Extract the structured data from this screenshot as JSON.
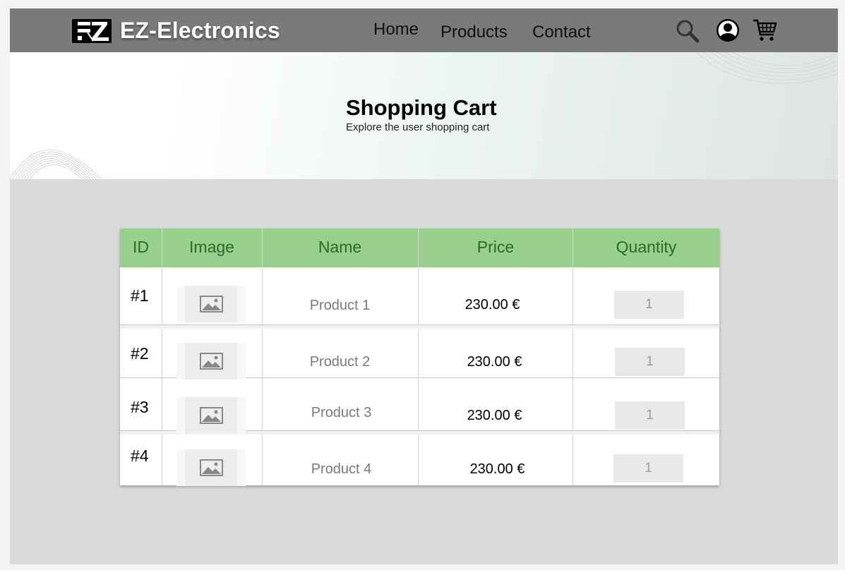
{
  "header": {
    "brand": "EZ-Electronics",
    "nav": [
      "Home",
      "Products",
      "Contact"
    ],
    "icons": [
      "search-icon",
      "user-icon",
      "cart-icon"
    ]
  },
  "hero": {
    "title": "Shopping Cart",
    "subtitle": "Explore the user shopping cart"
  },
  "cart": {
    "columns": [
      "ID",
      "Image",
      "Name",
      "Price",
      "Quantity"
    ],
    "rows": [
      {
        "id": "#1",
        "image": "image-placeholder-icon",
        "name": "Product 1",
        "price": "230.00 €",
        "quantity": "1"
      },
      {
        "id": "#2",
        "image": "image-placeholder-icon",
        "name": "Product 2",
        "price": "230.00 €",
        "quantity": "1"
      },
      {
        "id": "#3",
        "image": "image-placeholder-icon",
        "name": "Product 3",
        "price": "230.00 €",
        "quantity": "1"
      },
      {
        "id": "#4",
        "image": "image-placeholder-icon",
        "name": "Product 4",
        "price": "230.00 €",
        "quantity": "1"
      }
    ]
  },
  "colors": {
    "navbar": "#7a7a7a",
    "table_header": "#98cf8f",
    "table_header_text": "#2a6a2a",
    "content_bg": "#d9d9d9"
  }
}
